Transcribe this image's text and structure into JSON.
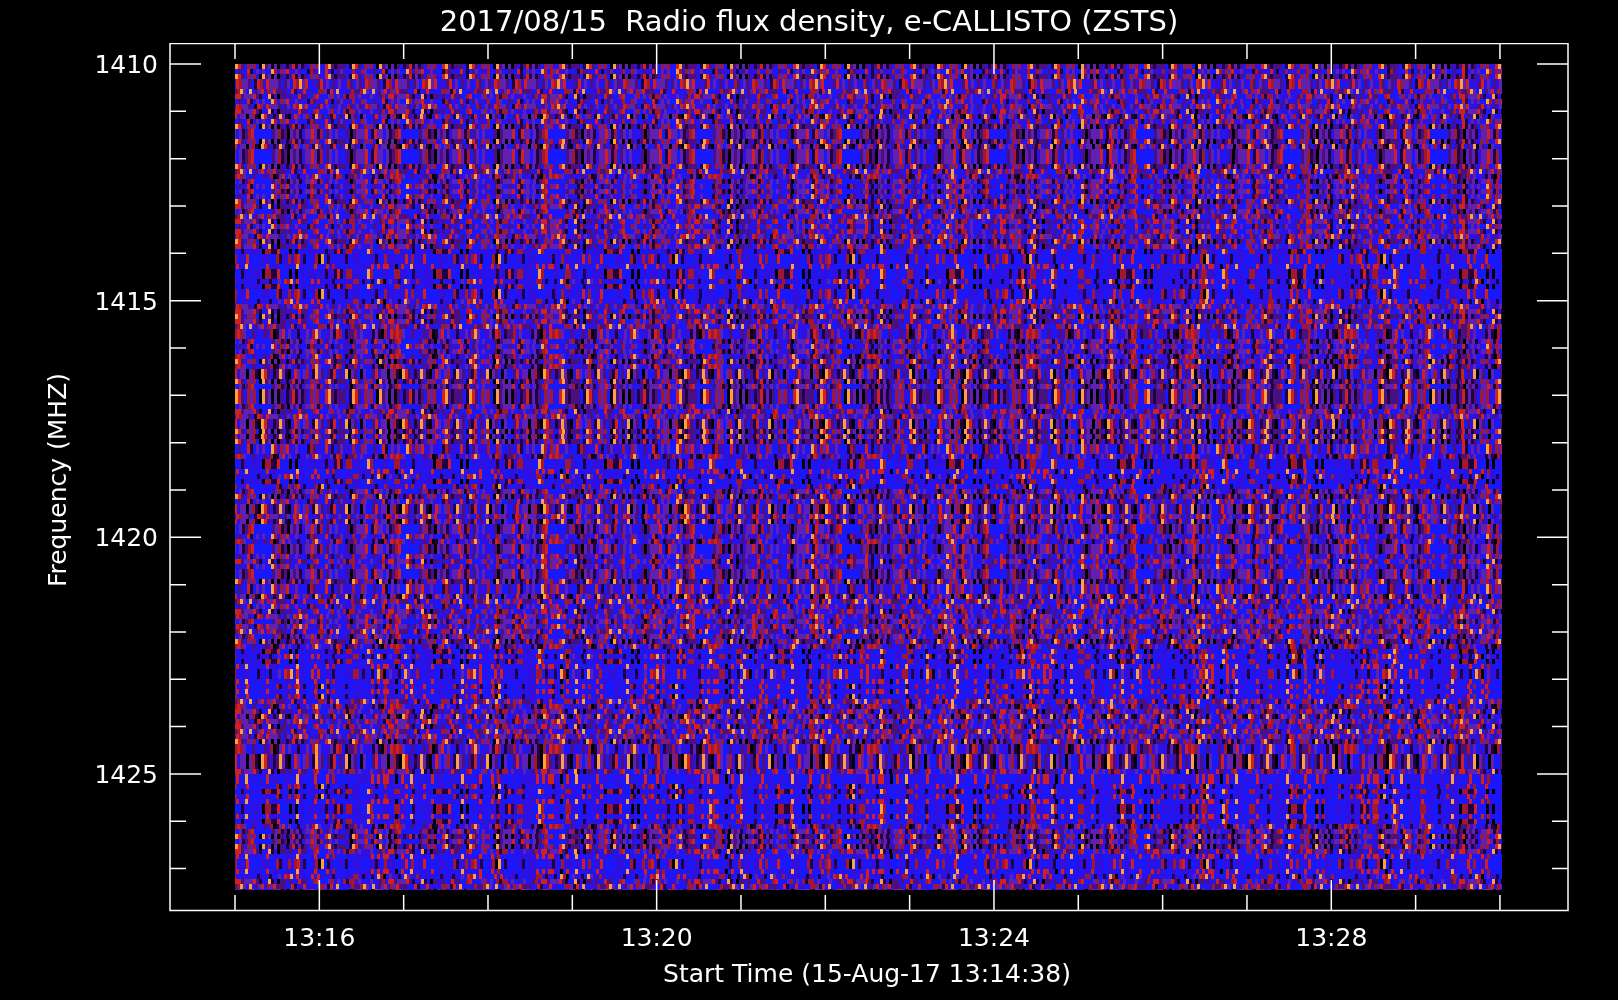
{
  "title": "2017/08/15  Radio flux density, e-CALLISTO (ZSTS)",
  "y_axis": {
    "label": "Frequency (MHZ)",
    "ticks": [
      "1410",
      "1415",
      "1420",
      "1425"
    ]
  },
  "x_axis": {
    "label": "Start Time (15-Aug-17 13:14:38)",
    "ticks": [
      "13:16",
      "13:20",
      "13:24",
      "13:28"
    ]
  }
}
